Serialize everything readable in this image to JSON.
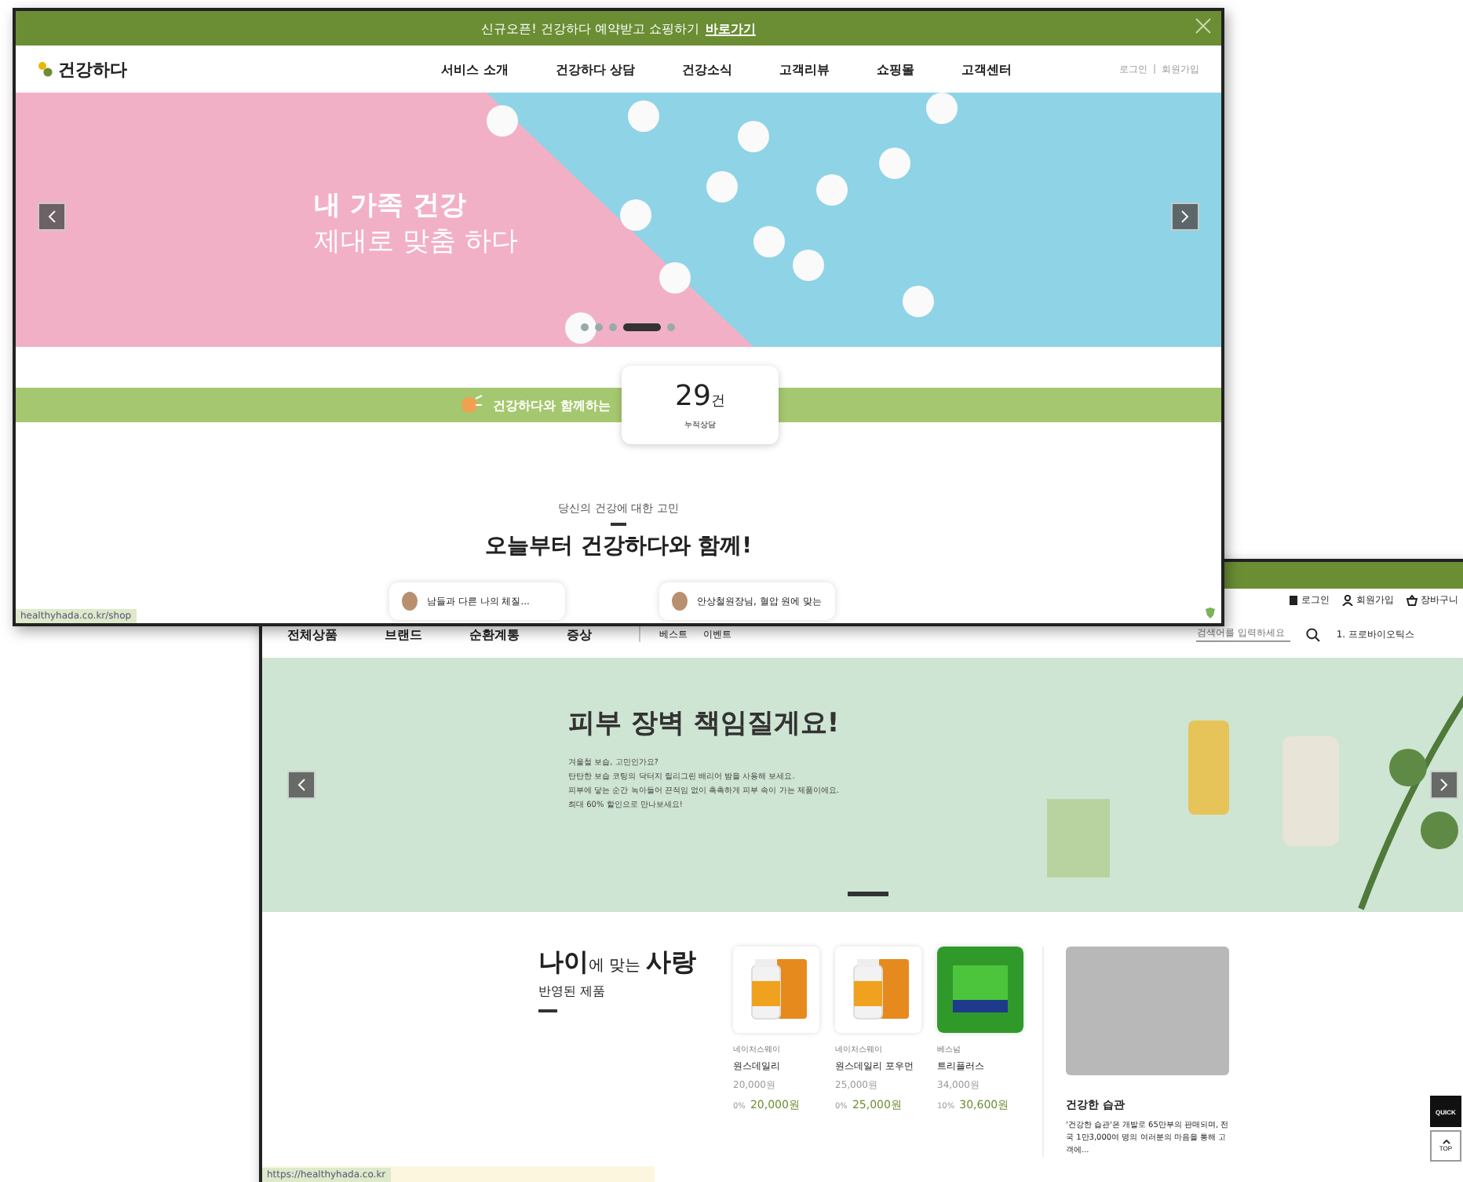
{
  "main_site": {
    "notice": {
      "text": "신규오픈! 건강하다 예약받고 쇼핑하기",
      "link": "바로가기"
    },
    "logo": "건강하다",
    "nav": [
      {
        "label": "서비스 소개"
      },
      {
        "label": "건강하다 상담"
      },
      {
        "label": "건강소식"
      },
      {
        "label": "고객리뷰"
      },
      {
        "label": "쇼핑몰"
      },
      {
        "label": "고객센터"
      }
    ],
    "account_links": [
      "로그인",
      "회원가입"
    ],
    "hero": {
      "title": "내 가족 건강",
      "subtitle": "제대로 맞춤 하다",
      "dots": [
        {
          "selected": false
        },
        {
          "selected": false
        },
        {
          "selected": false
        },
        {
          "selected": true
        },
        {
          "selected": false
        }
      ]
    },
    "stats": {
      "label": "건강하다와 함께하는",
      "count": "29",
      "unit": "건",
      "caption": "누적상담"
    },
    "intro": {
      "kicker": "당신의 건강에 대한 고민",
      "heading": "오늘부터 건강하다와 함께!"
    },
    "bubbles": [
      "남들과 다른 나의 체질...",
      "안상철원장님, 혈압 원에 맞는"
    ],
    "status_url": "healthyhada.co.kr/shop"
  },
  "shop_site": {
    "account_links": [
      {
        "kind": "login",
        "label": "로그인"
      },
      {
        "kind": "join",
        "label": "회원가입"
      },
      {
        "kind": "cart",
        "label": "장바구니"
      }
    ],
    "categories": [
      "전체상품",
      "브랜드",
      "순환계통",
      "증상"
    ],
    "sub_links": [
      "베스트",
      "이벤트"
    ],
    "search": {
      "placeholder": "검색어를 입력하세요"
    },
    "ranking": "1. 프로바이오틱스",
    "hero": {
      "title": "피부 장벽 책임질게요!",
      "lines": [
        "겨울철 보습, 고민인가요?",
        "탄탄한 보습 코팅의 닥터지 릴리그린 배리어 밤을 사용해 보세요.",
        "피부에 닿는 순간 녹아들어 끈적임 없이 촉촉하게 피부 속이 가는 제품이에요.",
        "최대 60% 할인으로 만나보세요!"
      ]
    },
    "section": {
      "title": "**나이**에 맞는 **사랑**",
      "subtitle": "반영된 제품"
    },
    "products": [
      {
        "kind": "bottle",
        "brand": "네이처스웨이",
        "name": "원스데일리",
        "original_price": "20,000원",
        "discount": "0%",
        "price": "20,000원"
      },
      {
        "kind": "bottle",
        "brand": "네이처스웨이",
        "name": "원스데일리 포우먼",
        "original_price": "25,000원",
        "discount": "0%",
        "price": "25,000원"
      },
      {
        "kind": "box",
        "brand": "베스넘",
        "name": "트리플러스",
        "original_price": "34,000원",
        "discount": "10%",
        "price": "30,600원"
      }
    ],
    "article": {
      "title": "건강한 습관",
      "text": "'건강한 습관'은 개발로 65만부의 판매되며, 전국 1만3,000여 명의 여러분의 마음을 통해 고객에..."
    },
    "quick": "QUICK",
    "top": "TOP",
    "status_url": "https://healthyhada.co.kr"
  }
}
